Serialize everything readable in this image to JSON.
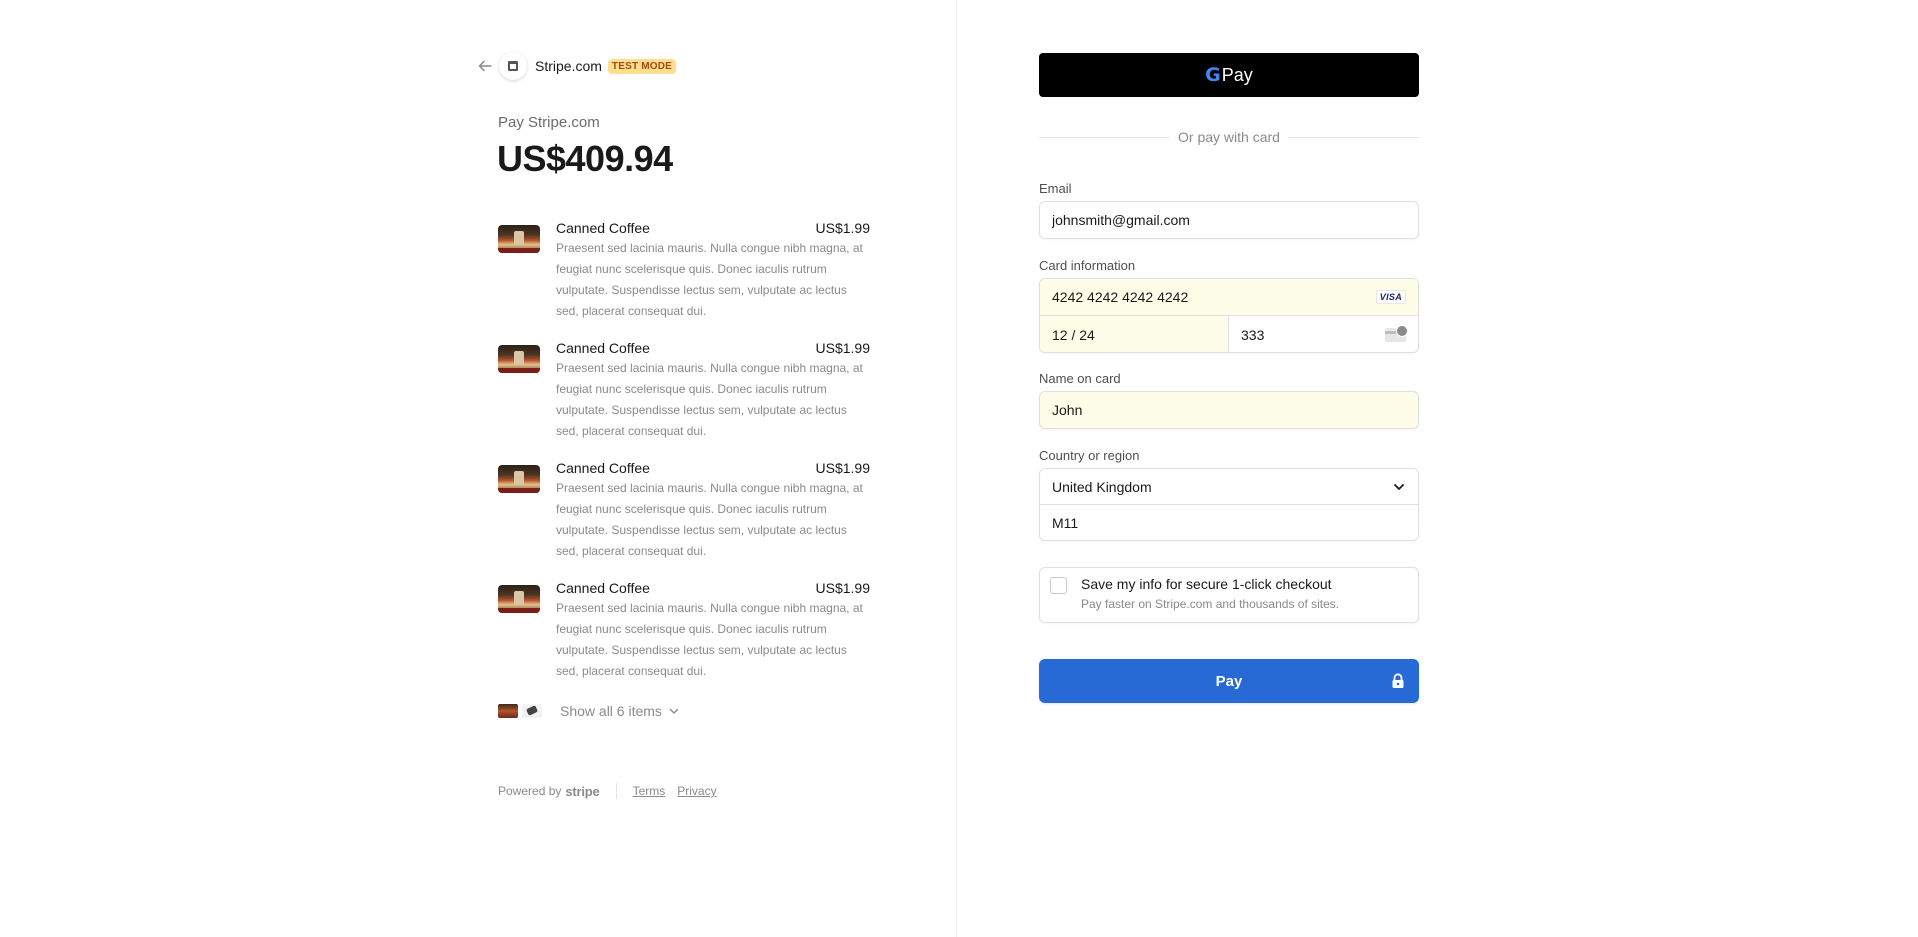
{
  "header": {
    "merchant_name": "Stripe.com",
    "mode_badge": "TEST MODE"
  },
  "summary": {
    "pay_label": "Pay Stripe.com",
    "amount": "US$409.94"
  },
  "items": [
    {
      "name": "Canned Coffee",
      "price": "US$1.99",
      "description": "Praesent sed lacinia mauris. Nulla congue nibh magna, at feugiat nunc scelerisque quis. Donec iaculis rutrum vulputate. Suspendisse lectus sem, vulputate ac lectus sed, placerat consequat dui."
    },
    {
      "name": "Canned Coffee",
      "price": "US$1.99",
      "description": "Praesent sed lacinia mauris. Nulla congue nibh magna, at feugiat nunc scelerisque quis. Donec iaculis rutrum vulputate. Suspendisse lectus sem, vulputate ac lectus sed, placerat consequat dui."
    },
    {
      "name": "Canned Coffee",
      "price": "US$1.99",
      "description": "Praesent sed lacinia mauris. Nulla congue nibh magna, at feugiat nunc scelerisque quis. Donec iaculis rutrum vulputate. Suspendisse lectus sem, vulputate ac lectus sed, placerat consequat dui."
    },
    {
      "name": "Canned Coffee",
      "price": "US$1.99",
      "description": "Praesent sed lacinia mauris. Nulla congue nibh magna, at feugiat nunc scelerisque quis. Donec iaculis rutrum vulputate. Suspendisse lectus sem, vulputate ac lectus sed, placerat consequat dui."
    }
  ],
  "show_all": "Show all 6 items",
  "footer": {
    "powered_by": "Powered by",
    "brand": "stripe",
    "terms": "Terms",
    "privacy": "Privacy"
  },
  "payment": {
    "gpay_label": "Pay",
    "divider_text": "Or pay with card",
    "email_label": "Email",
    "email_value": "johnsmith@gmail.com",
    "card_label": "Card information",
    "card_number": "4242 4242 4242 4242",
    "card_brand": "VISA",
    "card_expiry": "12 / 24",
    "card_cvc": "333",
    "name_label": "Name on card",
    "name_value": "John",
    "country_label": "Country or region",
    "country_value": "United Kingdom",
    "postal_value": "M11",
    "save_title": "Save my info for secure 1-click checkout",
    "save_subtitle": "Pay faster on Stripe.com and thousands of sites.",
    "pay_button": "Pay"
  },
  "colors": {
    "pay_button": "#276ad5",
    "autofill_bg": "#fefde8",
    "badge_bg": "#ffde92",
    "badge_text": "#a04d0c"
  },
  "icons": {
    "back": "arrow-left-icon",
    "merchant": "store-icon",
    "chevron": "chevron-down-icon",
    "lock": "lock-icon",
    "card_brand": "visa-icon",
    "cvc": "cvc-card-icon"
  }
}
